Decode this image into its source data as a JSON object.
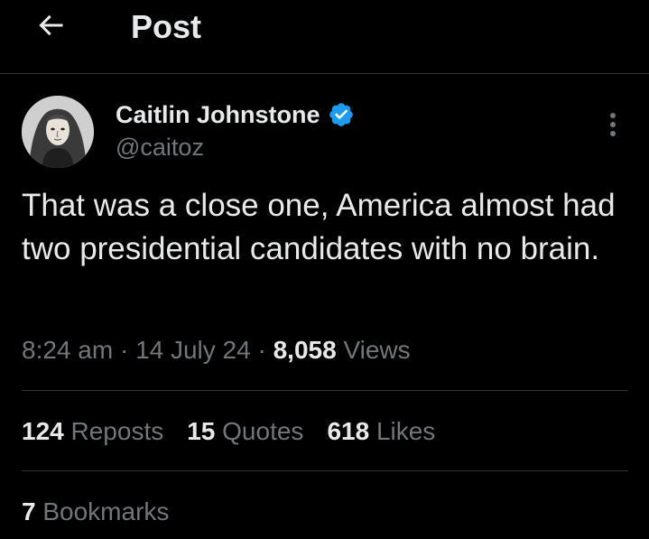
{
  "header": {
    "back_icon": "arrow-left-icon",
    "title": "Post"
  },
  "author": {
    "name": "Caitlin Johnstone",
    "handle": "@caitoz",
    "verified_color": "#1d9bf0",
    "avatar_icon": "profile-portrait"
  },
  "post": {
    "text": "That was a close one, America almost had two presidential candidates with no brain.",
    "time": "8:24 am",
    "date": "14 July 24",
    "views_count": "8,058",
    "views_label": "Views",
    "separator": "·"
  },
  "stats": {
    "reposts_count": "124",
    "reposts_label": "Reposts",
    "quotes_count": "15",
    "quotes_label": "Quotes",
    "likes_count": "618",
    "likes_label": "Likes",
    "bookmarks_count": "7",
    "bookmarks_label": "Bookmarks"
  },
  "colors": {
    "background": "#000000",
    "text_primary": "#e7e9ea",
    "text_secondary": "#71767b",
    "divider": "#2f3336",
    "accent": "#1d9bf0"
  }
}
